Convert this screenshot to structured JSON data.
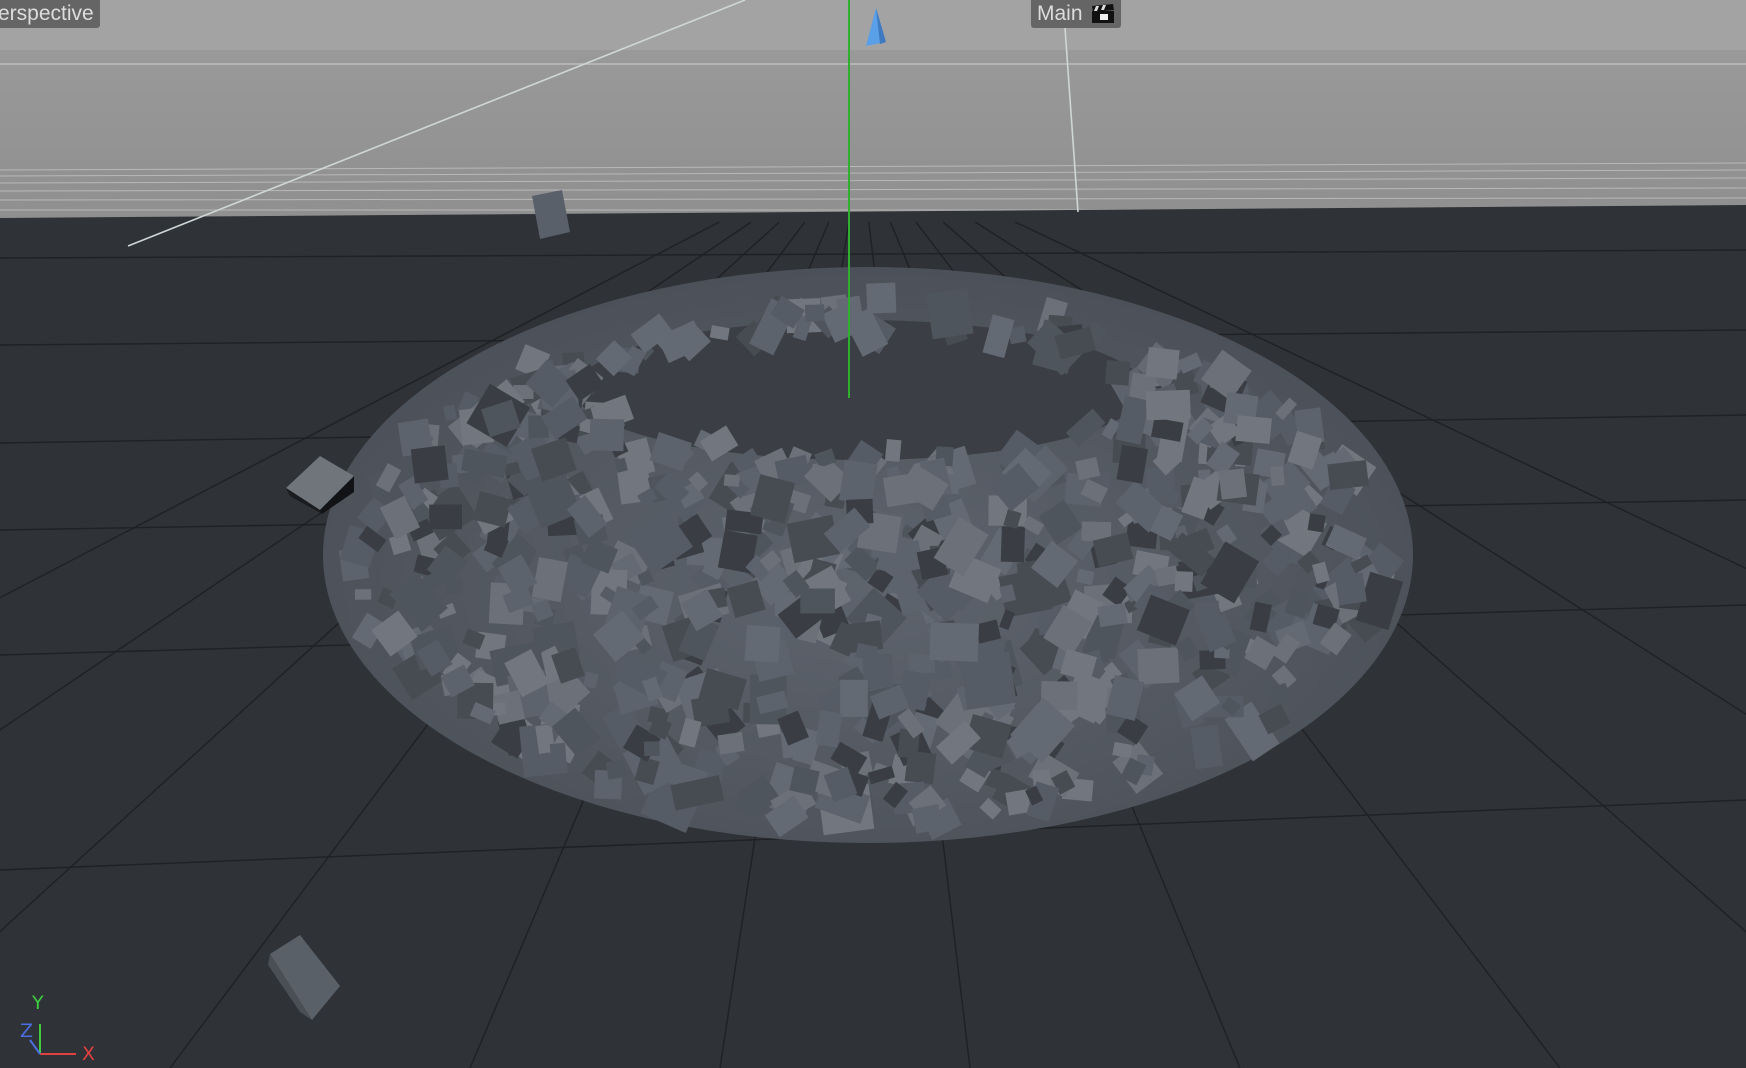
{
  "viewport": {
    "view_name": "erspective",
    "camera_name": "Main"
  },
  "colors": {
    "sky": "#9a9a9a",
    "floor": "#2f3236",
    "fragment": "#5b616a",
    "y_axis": "#3ecb3e",
    "z_axis": "#4a6fe0",
    "x_axis": "#e04040"
  },
  "icons": {
    "camera": "clapperboard-icon",
    "light_gizmo": "cone-icon",
    "axis_gizmo": "xyz-axes-icon"
  },
  "axis_gizmo": {
    "x": "X",
    "y": "Y",
    "z": "Z"
  }
}
